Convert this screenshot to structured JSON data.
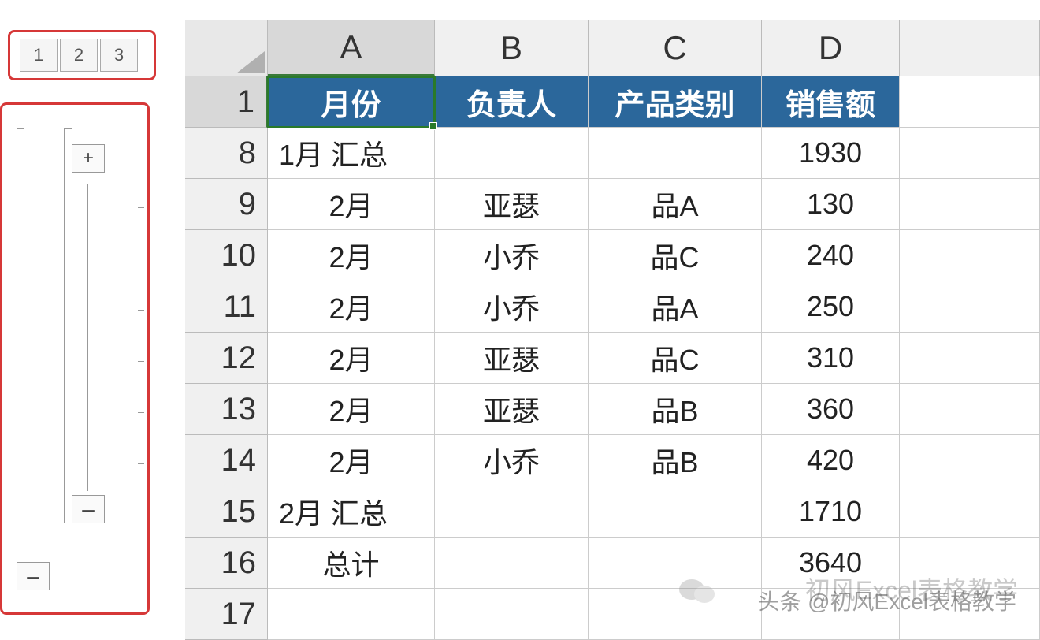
{
  "outline": {
    "levels": [
      "1",
      "2",
      "3"
    ],
    "plus": "+",
    "minus": "–"
  },
  "columns": [
    "A",
    "B",
    "C",
    "D",
    ""
  ],
  "rowNumbers": [
    "1",
    "8",
    "9",
    "10",
    "11",
    "12",
    "13",
    "14",
    "15",
    "16",
    "17"
  ],
  "headers": {
    "a": "月份",
    "b": "负责人",
    "c": "产品类别",
    "d": "销售额"
  },
  "rows": [
    {
      "a": "1月 汇总",
      "b": "",
      "c": "",
      "d": "1930"
    },
    {
      "a": "2月",
      "b": "亚瑟",
      "c": "品A",
      "d": "130"
    },
    {
      "a": "2月",
      "b": "小乔",
      "c": "品C",
      "d": "240"
    },
    {
      "a": "2月",
      "b": "小乔",
      "c": "品A",
      "d": "250"
    },
    {
      "a": "2月",
      "b": "亚瑟",
      "c": "品C",
      "d": "310"
    },
    {
      "a": "2月",
      "b": "亚瑟",
      "c": "品B",
      "d": "360"
    },
    {
      "a": "2月",
      "b": "小乔",
      "c": "品B",
      "d": "420"
    },
    {
      "a": "2月 汇总",
      "b": "",
      "c": "",
      "d": "1710"
    },
    {
      "a": "总计",
      "b": "",
      "c": "",
      "d": "3640"
    },
    {
      "a": "",
      "b": "",
      "c": "",
      "d": ""
    }
  ],
  "watermark": {
    "line1": "头条 @初风Excel表格教学",
    "line2": "初风Excel表格教学"
  }
}
